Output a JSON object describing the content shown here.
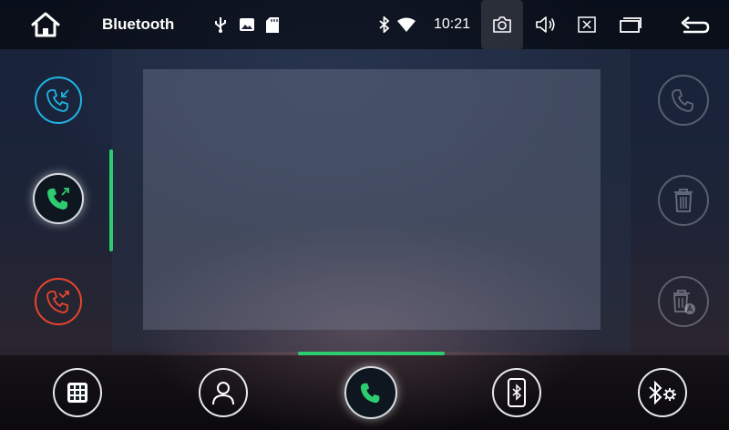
{
  "app": {
    "title": "Bluetooth"
  },
  "status_bar": {
    "time": "10:21",
    "indicators": [
      "usb-icon",
      "image-icon",
      "sd-card-icon",
      "bluetooth-icon",
      "wifi-icon"
    ],
    "actions": [
      "screenshot-camera-icon",
      "volume-icon",
      "close-window-icon",
      "recent-apps-icon",
      "back-icon"
    ]
  },
  "left_filters": [
    {
      "name": "incoming-calls",
      "icon": "incoming-call-icon",
      "color": "#1fb6e6",
      "selected": false
    },
    {
      "name": "outgoing-calls",
      "icon": "outgoing-call-icon",
      "color": "#2ecc71",
      "selected": true
    },
    {
      "name": "missed-calls",
      "icon": "missed-call-icon",
      "color": "#e8452d",
      "selected": false
    }
  ],
  "right_actions": [
    {
      "name": "dial",
      "icon": "phone-icon",
      "enabled": false
    },
    {
      "name": "delete",
      "icon": "trash-icon",
      "enabled": false
    },
    {
      "name": "delete-all",
      "icon": "trash-all-icon",
      "enabled": false
    }
  ],
  "bottom_nav": [
    {
      "name": "keypad",
      "icon": "dialpad-icon",
      "selected": false
    },
    {
      "name": "contacts",
      "icon": "contacts-icon",
      "selected": false
    },
    {
      "name": "call-log",
      "icon": "phone-icon",
      "selected": true
    },
    {
      "name": "devices",
      "icon": "phone-bluetooth-icon",
      "selected": false
    },
    {
      "name": "bluetooth-settings",
      "icon": "bluetooth-settings-icon",
      "selected": false
    }
  ],
  "colors": {
    "accent": "#2ecc71",
    "incoming": "#1fb6e6",
    "missed": "#e8452d"
  }
}
